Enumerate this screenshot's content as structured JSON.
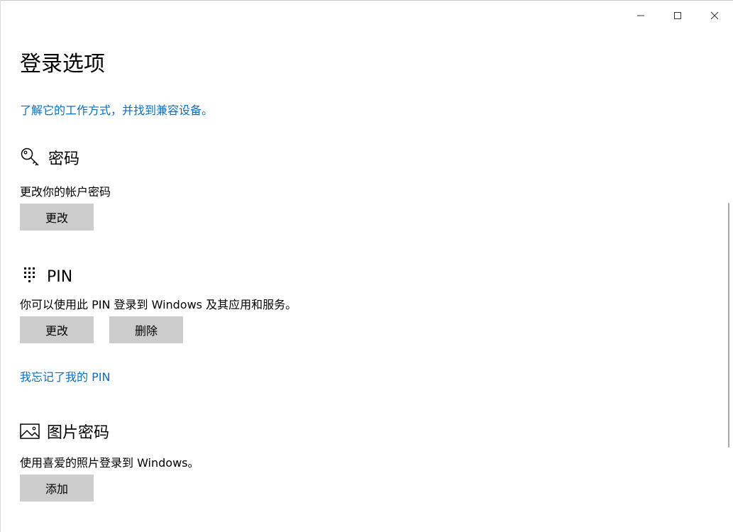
{
  "window": {
    "caption": {
      "minimize_icon": "minimize-icon",
      "maximize_icon": "maximize-icon",
      "close_icon": "close-icon"
    }
  },
  "page": {
    "title": "登录选项",
    "learn_link": "了解它的工作方式，并找到兼容设备。"
  },
  "password": {
    "icon": "key-icon",
    "title": "密码",
    "description": "更改你的帐户密码",
    "change_button": "更改"
  },
  "pin": {
    "icon": "pin-keypad-icon",
    "title": "PIN",
    "description": "你可以使用此 PIN 登录到 Windows 及其应用和服务。",
    "change_button": "更改",
    "remove_button": "删除",
    "forgot_link": "我忘记了我的 PIN"
  },
  "picture_password": {
    "icon": "picture-icon",
    "title": "图片密码",
    "description": "使用喜爱的照片登录到 Windows。",
    "add_button": "添加"
  },
  "colors": {
    "link": "#0a6fc2",
    "button_bg": "#cccccc",
    "text": "#000000",
    "background": "#ffffff"
  }
}
